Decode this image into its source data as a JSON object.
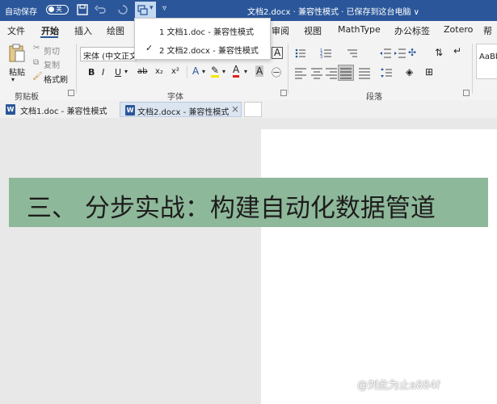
{
  "titlebar": {
    "autosave_label": "自动保存",
    "autosave_state": "关",
    "document_title": "文档2.docx · 兼容性模式 · 已保存到这台电脑 ∨",
    "background": "#2b579a"
  },
  "menu": {
    "tabs": [
      "文件",
      "开始",
      "插入",
      "绘图",
      "审阅",
      "视图",
      "MathType",
      "办公标签",
      "Zotero",
      "帮"
    ],
    "active": "开始"
  },
  "dropdown": {
    "items": [
      {
        "label": "1 文档1.doc  -  兼容性模式",
        "checked": false
      },
      {
        "label": "2 文档2.docx  -  兼容性模式",
        "checked": true
      }
    ]
  },
  "ribbon": {
    "clipboard": {
      "paste_label": "粘贴",
      "cut_label": "剪切",
      "copy_label": "复制",
      "format_painter_label": "格式刷",
      "group_label": "剪贴板"
    },
    "font": {
      "font_name": "宋体 (中文正文)",
      "group_label": "字体",
      "bold": "B",
      "italic": "I",
      "underline": "U",
      "strike": "ab",
      "font_color_letter": "A",
      "highlight_letter": "A",
      "clear_letter": "A",
      "style_preview": "AaBb"
    },
    "paragraph": {
      "group_label": "段落"
    }
  },
  "doc_tabs": [
    {
      "label": "文档1.doc - 兼容性模式",
      "active": false
    },
    {
      "label": "文档2.docx - 兼容性模式",
      "active": true,
      "close": "×"
    }
  ],
  "content": {
    "banner_text": "三、 分步实战：构建自动化数据管道",
    "banner_color": "#8eb89a",
    "watermark": "@刘此为止a884f"
  }
}
